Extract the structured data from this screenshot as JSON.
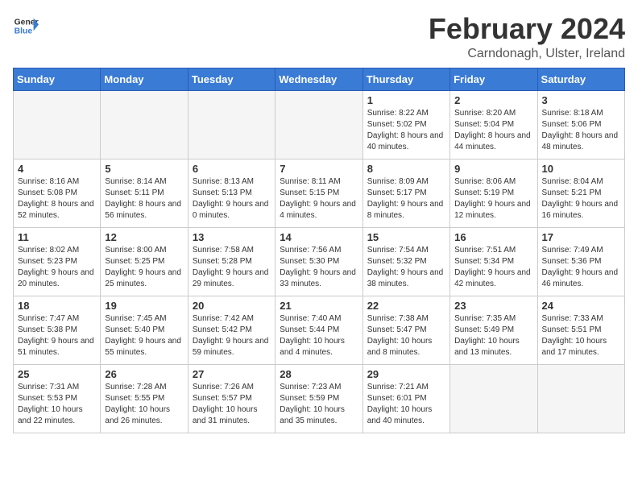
{
  "header": {
    "logo_line1": "General",
    "logo_line2": "Blue",
    "month": "February 2024",
    "location": "Carndonagh, Ulster, Ireland"
  },
  "weekdays": [
    "Sunday",
    "Monday",
    "Tuesday",
    "Wednesday",
    "Thursday",
    "Friday",
    "Saturday"
  ],
  "weeks": [
    [
      {
        "day": "",
        "empty": true
      },
      {
        "day": "",
        "empty": true
      },
      {
        "day": "",
        "empty": true
      },
      {
        "day": "",
        "empty": true
      },
      {
        "day": "1",
        "sunrise": "8:22 AM",
        "sunset": "5:02 PM",
        "daylight": "8 hours and 40 minutes."
      },
      {
        "day": "2",
        "sunrise": "8:20 AM",
        "sunset": "5:04 PM",
        "daylight": "8 hours and 44 minutes."
      },
      {
        "day": "3",
        "sunrise": "8:18 AM",
        "sunset": "5:06 PM",
        "daylight": "8 hours and 48 minutes."
      }
    ],
    [
      {
        "day": "4",
        "sunrise": "8:16 AM",
        "sunset": "5:08 PM",
        "daylight": "8 hours and 52 minutes."
      },
      {
        "day": "5",
        "sunrise": "8:14 AM",
        "sunset": "5:11 PM",
        "daylight": "8 hours and 56 minutes."
      },
      {
        "day": "6",
        "sunrise": "8:13 AM",
        "sunset": "5:13 PM",
        "daylight": "9 hours and 0 minutes."
      },
      {
        "day": "7",
        "sunrise": "8:11 AM",
        "sunset": "5:15 PM",
        "daylight": "9 hours and 4 minutes."
      },
      {
        "day": "8",
        "sunrise": "8:09 AM",
        "sunset": "5:17 PM",
        "daylight": "9 hours and 8 minutes."
      },
      {
        "day": "9",
        "sunrise": "8:06 AM",
        "sunset": "5:19 PM",
        "daylight": "9 hours and 12 minutes."
      },
      {
        "day": "10",
        "sunrise": "8:04 AM",
        "sunset": "5:21 PM",
        "daylight": "9 hours and 16 minutes."
      }
    ],
    [
      {
        "day": "11",
        "sunrise": "8:02 AM",
        "sunset": "5:23 PM",
        "daylight": "9 hours and 20 minutes."
      },
      {
        "day": "12",
        "sunrise": "8:00 AM",
        "sunset": "5:25 PM",
        "daylight": "9 hours and 25 minutes."
      },
      {
        "day": "13",
        "sunrise": "7:58 AM",
        "sunset": "5:28 PM",
        "daylight": "9 hours and 29 minutes."
      },
      {
        "day": "14",
        "sunrise": "7:56 AM",
        "sunset": "5:30 PM",
        "daylight": "9 hours and 33 minutes."
      },
      {
        "day": "15",
        "sunrise": "7:54 AM",
        "sunset": "5:32 PM",
        "daylight": "9 hours and 38 minutes."
      },
      {
        "day": "16",
        "sunrise": "7:51 AM",
        "sunset": "5:34 PM",
        "daylight": "9 hours and 42 minutes."
      },
      {
        "day": "17",
        "sunrise": "7:49 AM",
        "sunset": "5:36 PM",
        "daylight": "9 hours and 46 minutes."
      }
    ],
    [
      {
        "day": "18",
        "sunrise": "7:47 AM",
        "sunset": "5:38 PM",
        "daylight": "9 hours and 51 minutes."
      },
      {
        "day": "19",
        "sunrise": "7:45 AM",
        "sunset": "5:40 PM",
        "daylight": "9 hours and 55 minutes."
      },
      {
        "day": "20",
        "sunrise": "7:42 AM",
        "sunset": "5:42 PM",
        "daylight": "9 hours and 59 minutes."
      },
      {
        "day": "21",
        "sunrise": "7:40 AM",
        "sunset": "5:44 PM",
        "daylight": "10 hours and 4 minutes."
      },
      {
        "day": "22",
        "sunrise": "7:38 AM",
        "sunset": "5:47 PM",
        "daylight": "10 hours and 8 minutes."
      },
      {
        "day": "23",
        "sunrise": "7:35 AM",
        "sunset": "5:49 PM",
        "daylight": "10 hours and 13 minutes."
      },
      {
        "day": "24",
        "sunrise": "7:33 AM",
        "sunset": "5:51 PM",
        "daylight": "10 hours and 17 minutes."
      }
    ],
    [
      {
        "day": "25",
        "sunrise": "7:31 AM",
        "sunset": "5:53 PM",
        "daylight": "10 hours and 22 minutes."
      },
      {
        "day": "26",
        "sunrise": "7:28 AM",
        "sunset": "5:55 PM",
        "daylight": "10 hours and 26 minutes."
      },
      {
        "day": "27",
        "sunrise": "7:26 AM",
        "sunset": "5:57 PM",
        "daylight": "10 hours and 31 minutes."
      },
      {
        "day": "28",
        "sunrise": "7:23 AM",
        "sunset": "5:59 PM",
        "daylight": "10 hours and 35 minutes."
      },
      {
        "day": "29",
        "sunrise": "7:21 AM",
        "sunset": "6:01 PM",
        "daylight": "10 hours and 40 minutes."
      },
      {
        "day": "",
        "empty": true
      },
      {
        "day": "",
        "empty": true
      }
    ]
  ],
  "labels": {
    "sunrise_prefix": "Sunrise: ",
    "sunset_prefix": "Sunset: ",
    "daylight_prefix": "Daylight: "
  }
}
